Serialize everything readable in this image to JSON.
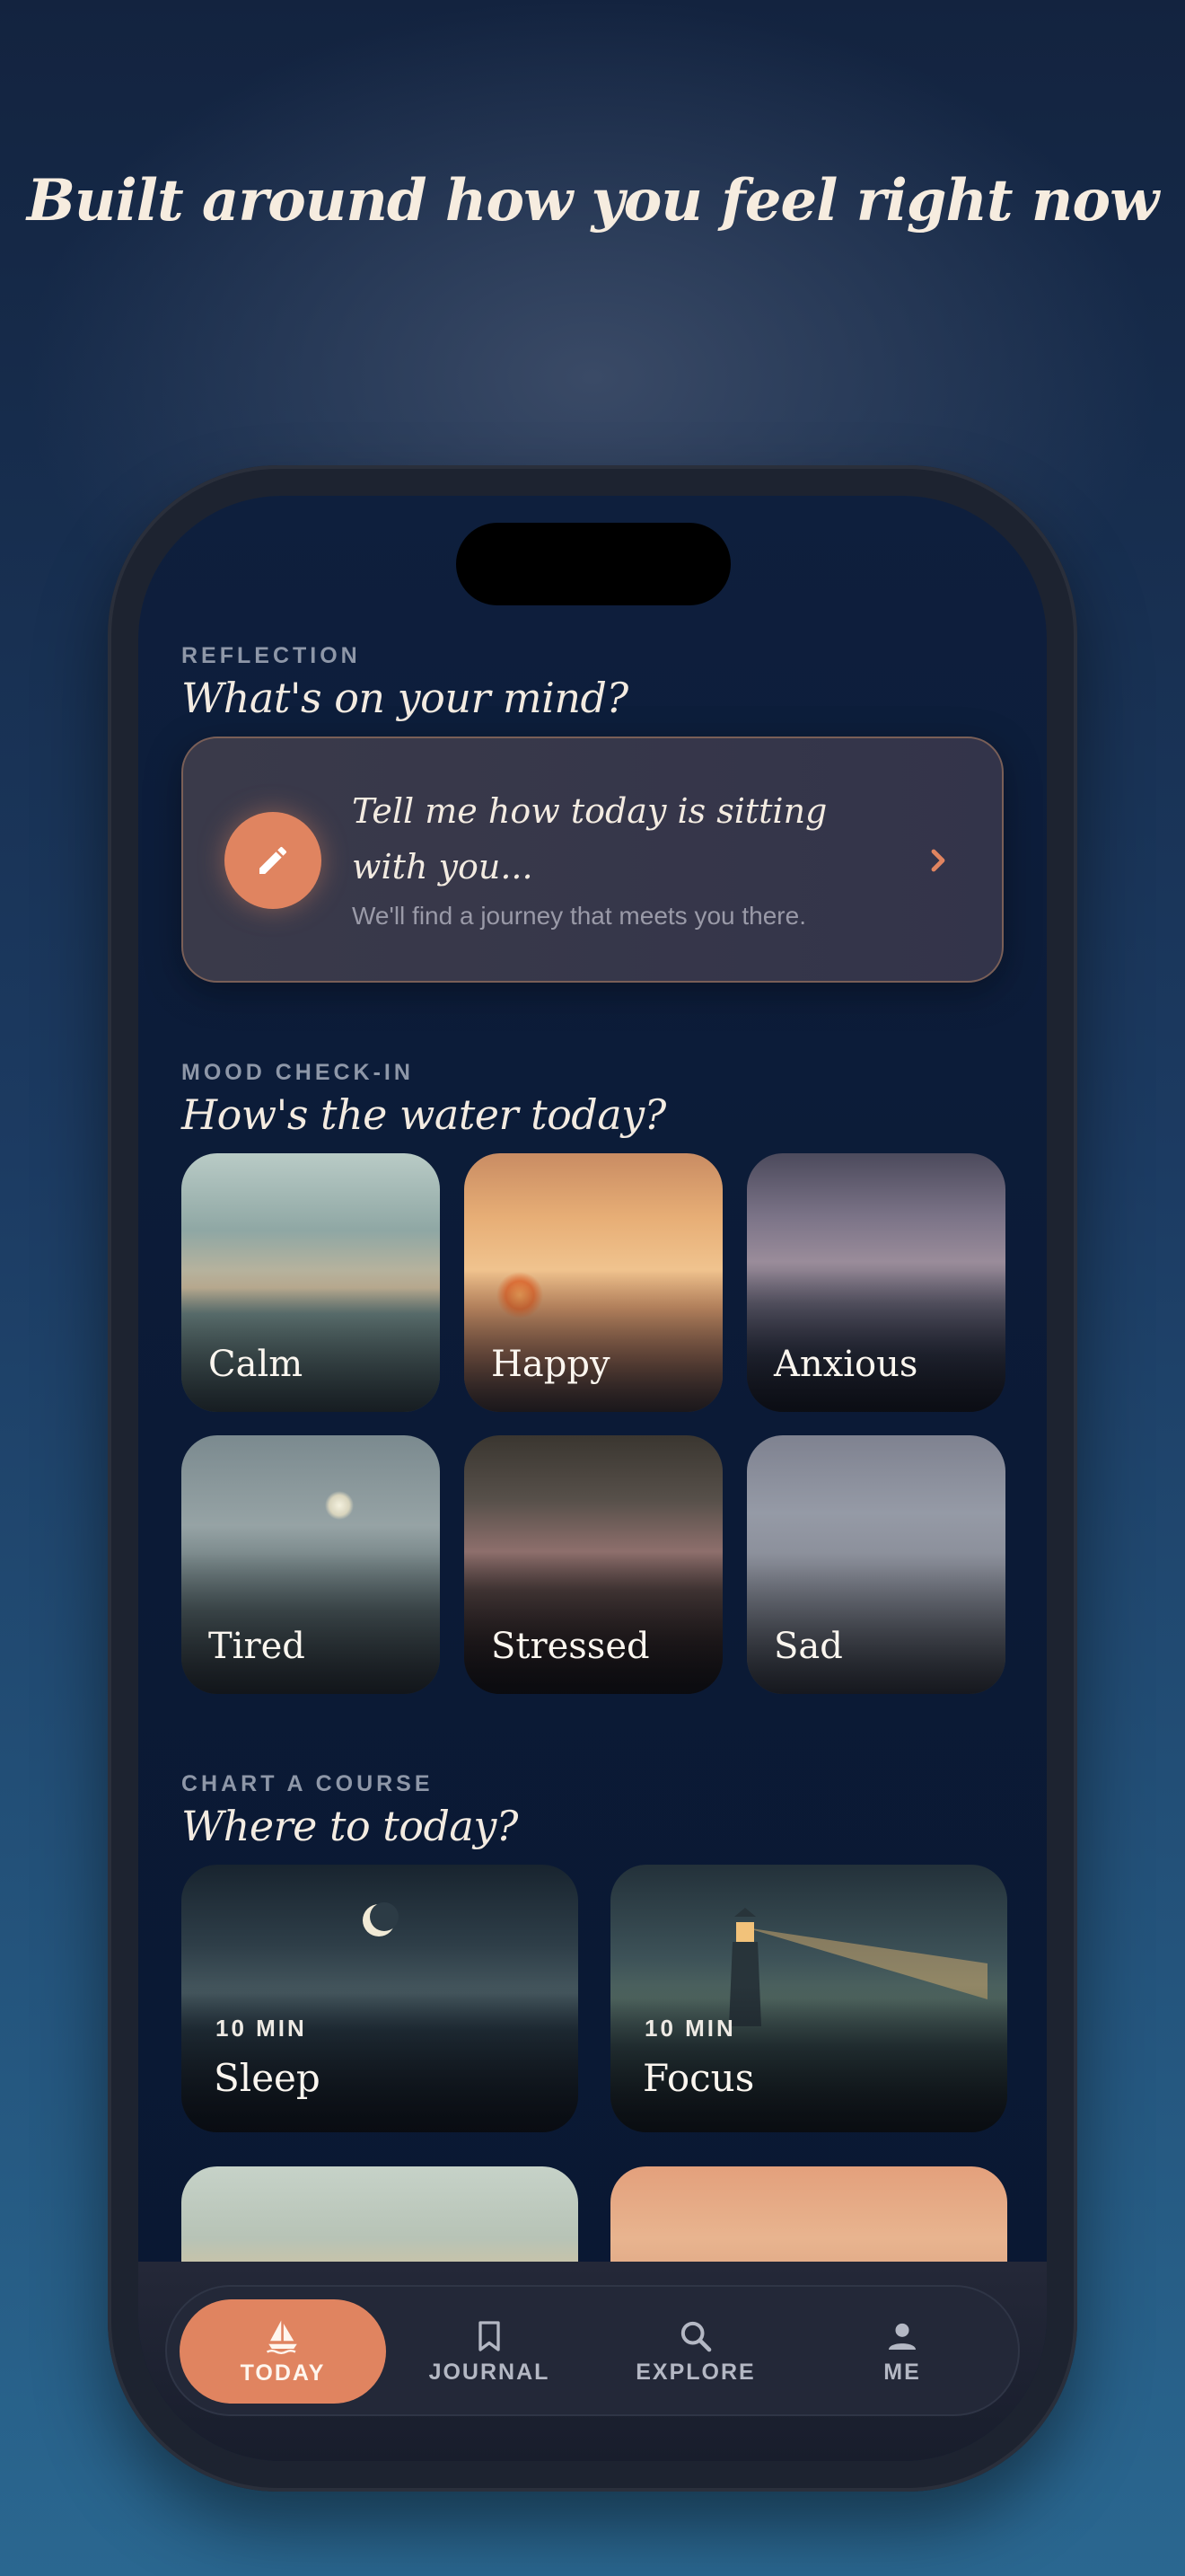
{
  "headline": "Built around how you feel right now",
  "reflection": {
    "eyebrow": "REFLECTION",
    "title": "What's on your mind?",
    "prompt": "Tell me how today is sitting with you...",
    "subtitle": "We'll find a journey that meets you there."
  },
  "mood": {
    "eyebrow": "MOOD CHECK-IN",
    "title": "How's the water today?",
    "items": [
      {
        "label": "Calm"
      },
      {
        "label": "Happy"
      },
      {
        "label": "Anxious"
      },
      {
        "label": "Tired"
      },
      {
        "label": "Stressed"
      },
      {
        "label": "Sad"
      }
    ]
  },
  "course": {
    "eyebrow": "CHART A COURSE",
    "title": "Where to today?",
    "items": [
      {
        "duration": "10 MIN",
        "label": "Sleep"
      },
      {
        "duration": "10 MIN",
        "label": "Focus"
      }
    ]
  },
  "tabs": [
    {
      "label": "TODAY",
      "icon": "sailboat-icon",
      "active": true
    },
    {
      "label": "JOURNAL",
      "icon": "bookmark-icon",
      "active": false
    },
    {
      "label": "EXPLORE",
      "icon": "search-icon",
      "active": false
    },
    {
      "label": "ME",
      "icon": "person-icon",
      "active": false
    }
  ],
  "colors": {
    "accent": "#e08460",
    "background": "#0b1a36",
    "text": "#f3ebe1"
  }
}
